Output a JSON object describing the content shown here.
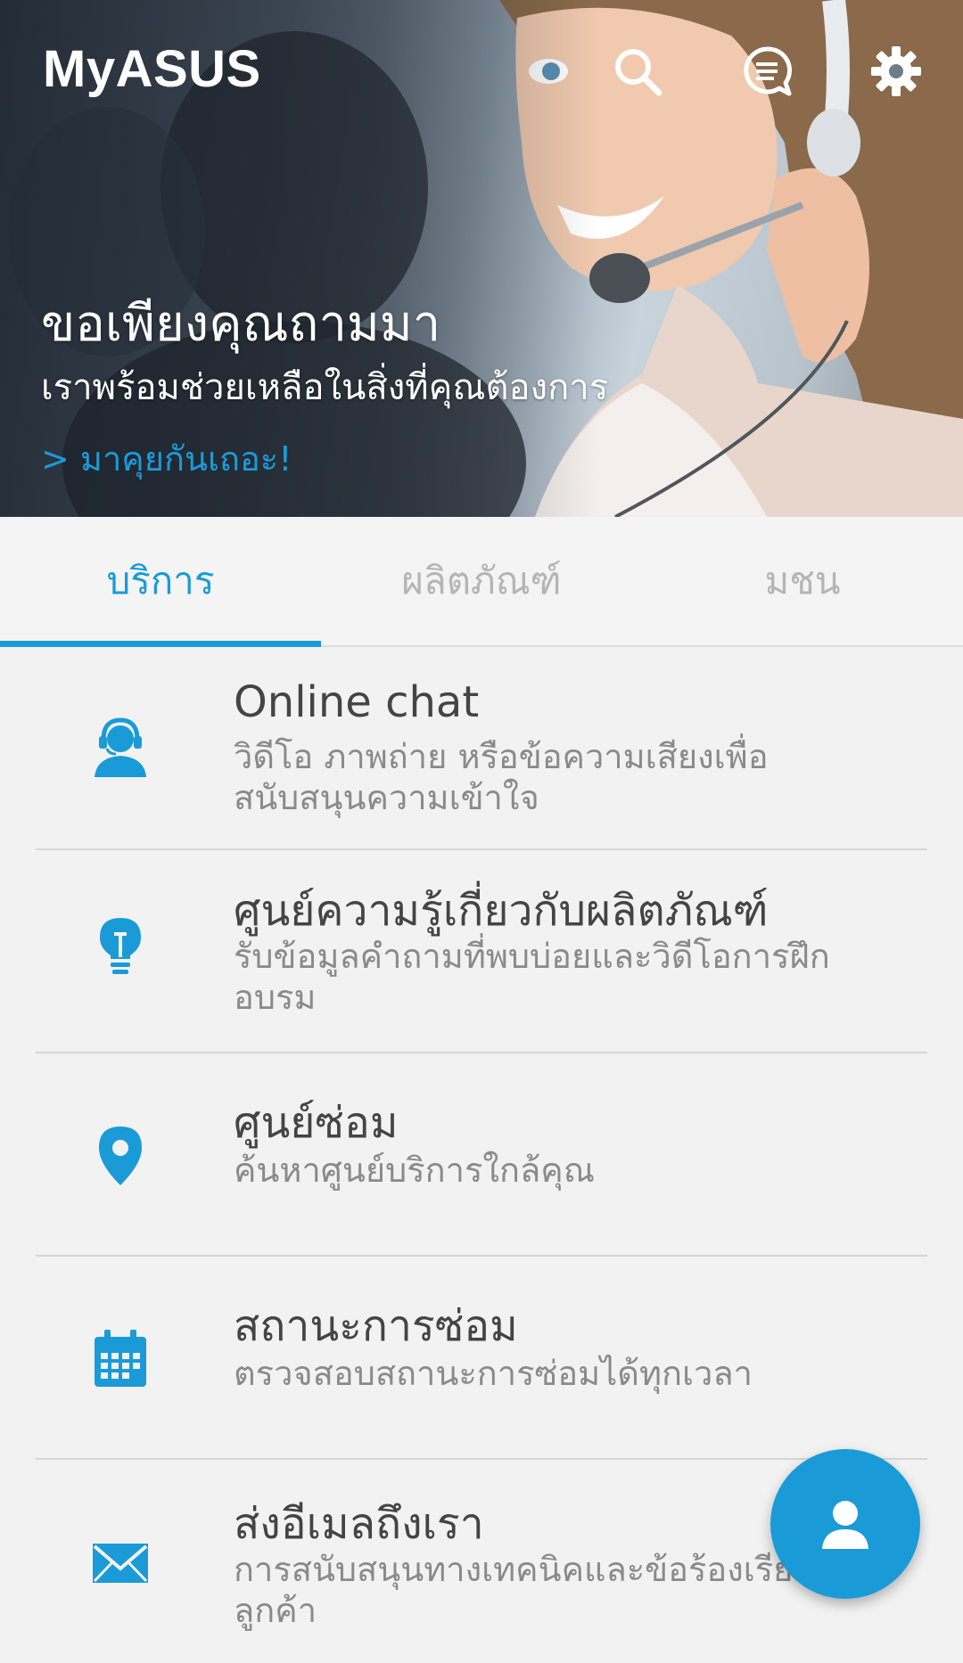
{
  "app": {
    "title": "MyASUS"
  },
  "toolbar": {
    "icons": [
      "search-icon",
      "chat-message-icon",
      "gear-icon"
    ]
  },
  "hero": {
    "headline": "ขอเพียงคุณถามมา",
    "subtitle": "เราพร้อมช่วยเหลือในสิ่งที่คุณต้องการ",
    "link": "> มาคุยกันเถอะ!"
  },
  "tabs": [
    {
      "label": "บริการ",
      "active": true
    },
    {
      "label": "ผลิตภัณฑ์",
      "active": false
    },
    {
      "label": "มชน",
      "active": false
    }
  ],
  "services": [
    {
      "icon": "headset-agent-icon",
      "title": "Online chat",
      "desc": "วิดีโอ ภาพถ่าย หรือข้อความเสียงเพื่อสนับสนุนความเข้าใจ"
    },
    {
      "icon": "lightbulb-icon",
      "title": "ศูนย์ความรู้เกี่ยวกับผลิตภัณฑ์",
      "desc": "รับข้อมูลคำถามที่พบบ่อยและวิดีโอการฝึกอบรม"
    },
    {
      "icon": "map-pin-icon",
      "title": "ศูนย์ซ่อม",
      "desc": "ค้นหาศูนย์บริการใกล้คุณ"
    },
    {
      "icon": "calendar-icon",
      "title": "สถานะการซ่อม",
      "desc": "ตรวจสอบสถานะการซ่อมได้ทุกเวลา"
    },
    {
      "icon": "envelope-icon",
      "title": "ส่งอีเมลถึงเรา",
      "desc": "การสนับสนุนทางเทคนิคและข้อร้องเรียนของลูกค้า"
    }
  ],
  "fab": {
    "icon": "person-icon"
  },
  "colors": {
    "accent": "#1a9bd8",
    "title_text": "#444444",
    "desc_text": "#8a8a8a",
    "tab_inactive": "#b5b5b5"
  }
}
